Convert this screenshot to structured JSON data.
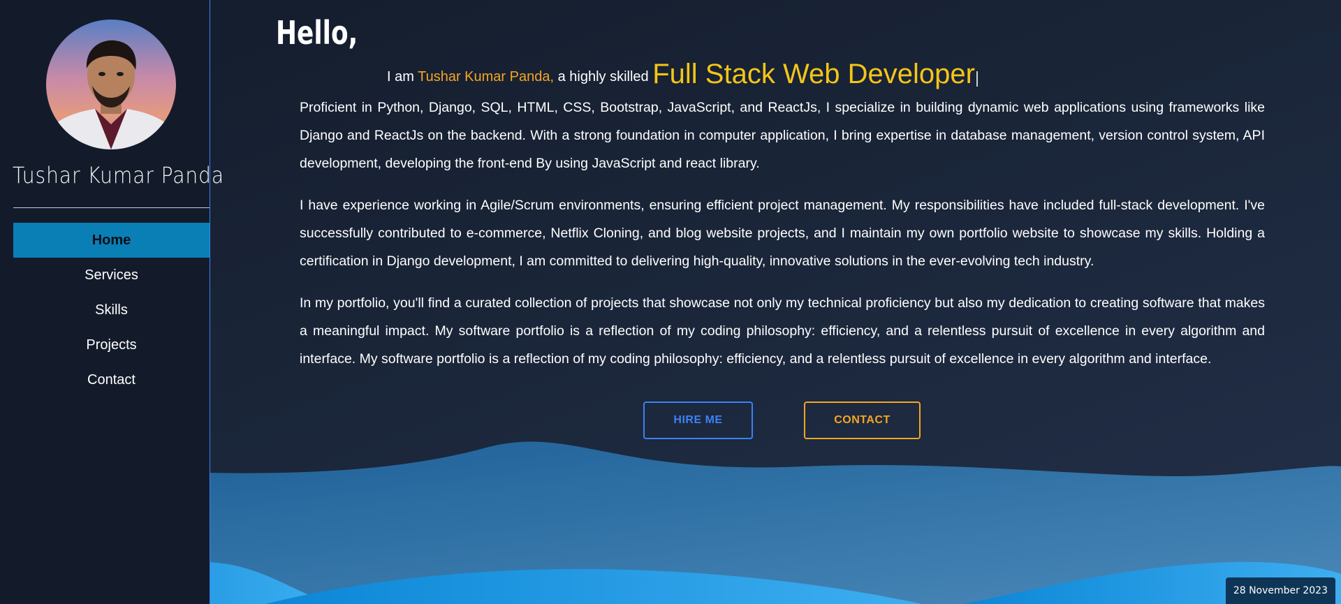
{
  "sidebar": {
    "name": "Tushar Kumar Panda",
    "nav": [
      {
        "label": "Home",
        "active": true
      },
      {
        "label": "Services",
        "active": false
      },
      {
        "label": "Skills",
        "active": false
      },
      {
        "label": "Projects",
        "active": false
      },
      {
        "label": "Contact",
        "active": false
      }
    ]
  },
  "hero": {
    "greeting": "Hello,",
    "intro_prefix": "I am",
    "name": "Tushar Kumar Panda,",
    "intro_middle": "a highly skilled",
    "role": "Full Stack Web Developer",
    "paragraphs": [
      "Proficient in Python, Django, SQL, HTML, CSS, Bootstrap, JavaScript, and ReactJs, I specialize in building dynamic web applications using frameworks like Django and ReactJs on the backend. With a strong foundation in computer application, I bring expertise in database management, version control system, API development, developing the front-end By using JavaScript and react library.",
      "I have experience working in Agile/Scrum environments, ensuring efficient project management. My responsibilities have included full-stack development. I've successfully contributed to e-commerce, Netflix Cloning, and blog website projects, and I maintain my own portfolio website to showcase my skills. Holding a certification in Django development, I am committed to delivering high-quality, innovative solutions in the ever-evolving tech industry.",
      "In my portfolio, you'll find a curated collection of projects that showcase not only my technical proficiency but also my dedication to creating software that makes a meaningful impact. My software portfolio is a reflection of my coding philosophy: efficiency, and a relentless pursuit of excellence in every algorithm and interface. My software portfolio is a reflection of my coding philosophy: efficiency, and a relentless pursuit of excellence in every algorithm and interface."
    ],
    "hire_label": "HIRE ME",
    "contact_label": "CONTACT"
  },
  "date_badge": "28 November 2023",
  "colors": {
    "accent_blue": "#3b82f6",
    "accent_orange": "#f5a623",
    "role_yellow": "#f5c518",
    "active_nav": "#0a7fb6"
  }
}
